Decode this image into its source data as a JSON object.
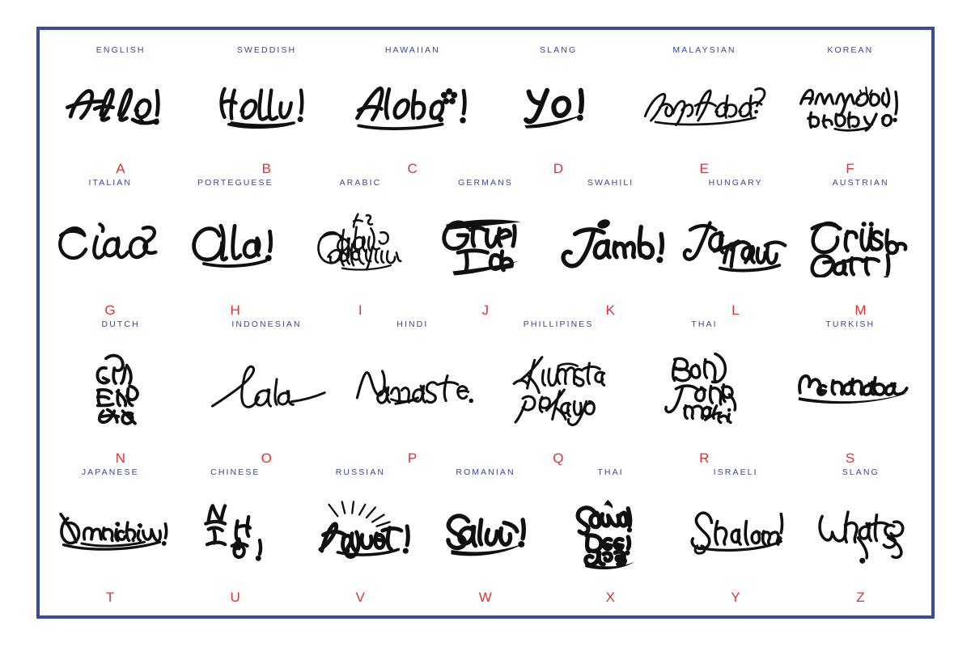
{
  "poster": {
    "border_color": "#3d4b9b",
    "background_color": "#ffffff",
    "label_color": "#3b4693",
    "key_color": "#e8302f",
    "ink_color": "#101010"
  },
  "rows": [
    {
      "cells": [
        {
          "language": "ENGLISH",
          "key": "A",
          "greeting": "Hello!",
          "art": "hello"
        },
        {
          "language": "SWEDDISH",
          "key": "B",
          "greeting": "Hallu!",
          "art": "hallu"
        },
        {
          "language": "HAWAIIAN",
          "key": "C",
          "greeting": "Aloha!",
          "art": "aloha"
        },
        {
          "language": "SLANG",
          "key": "D",
          "greeting": "Yo!",
          "art": "yo"
        },
        {
          "language": "MALAYSIAN",
          "key": "E",
          "greeting": "Apa Kabar?",
          "art": "apakabar"
        },
        {
          "language": "KOREAN",
          "key": "F",
          "greeting": "Annyeong Haseyo!",
          "art": "annyeong"
        }
      ]
    },
    {
      "cells": [
        {
          "language": "ITALIAN",
          "key": "G",
          "greeting": "Ciao",
          "art": "ciao"
        },
        {
          "language": "PORTEGUESE",
          "key": "H",
          "greeting": "Ola!",
          "art": "ola"
        },
        {
          "language": "ARABIC",
          "key": "I",
          "greeting": "As Salamu Alaykum",
          "art": "assalam"
        },
        {
          "language": "GERMANS",
          "key": "J",
          "greeting": "Guten Tag",
          "art": "gutentag"
        },
        {
          "language": "SWAHILI",
          "key": "K",
          "greeting": "Jambo!",
          "art": "jambo"
        },
        {
          "language": "HUNGARY",
          "key": "L",
          "greeting": "Jo Napot",
          "art": "jonapot"
        },
        {
          "language": "AUSTRIAN",
          "key": "M",
          "greeting": "Grüß Gott!",
          "art": "grussgott"
        }
      ]
    },
    {
      "cells": [
        {
          "language": "DUTCH",
          "key": "N",
          "greeting": "Gud End Ag",
          "art": "gudendag"
        },
        {
          "language": "INDONESIAN",
          "key": "O",
          "greeting": "Halo",
          "art": "halo"
        },
        {
          "language": "HINDI",
          "key": "P",
          "greeting": "Namaste!",
          "art": "namaste"
        },
        {
          "language": "PHILLIPINES",
          "key": "Q",
          "greeting": "Kumusta Pa Kayo",
          "art": "kumusta"
        },
        {
          "language": "THAI",
          "key": "R",
          "greeting": "Bon Jour Mon Ami",
          "art": "bonjour"
        },
        {
          "language": "TURKISH",
          "key": "S",
          "greeting": "Merhaba",
          "art": "merhaba"
        }
      ]
    },
    {
      "cells": [
        {
          "language": "JAPANESE",
          "key": "T",
          "greeting": "Konnichiwa!",
          "art": "konnichiwa"
        },
        {
          "language": "CHINESE",
          "key": "U",
          "greeting": "Ni Hao!",
          "art": "nihao"
        },
        {
          "language": "RUSSIAN",
          "key": "V",
          "greeting": "Privyet!",
          "art": "privyet"
        },
        {
          "language": "ROMANIAN",
          "key": "W",
          "greeting": "Salut!",
          "art": "salut"
        },
        {
          "language": "THAI",
          "key": "X",
          "greeting": "Sawa Dee! Krab",
          "art": "sawadee"
        },
        {
          "language": "ISRAELI",
          "key": "Y",
          "greeting": "Shalom!",
          "art": "shalom"
        },
        {
          "language": "SLANG",
          "key": "Z",
          "greeting": "Whatsup?",
          "art": "whatsup"
        }
      ]
    }
  ]
}
